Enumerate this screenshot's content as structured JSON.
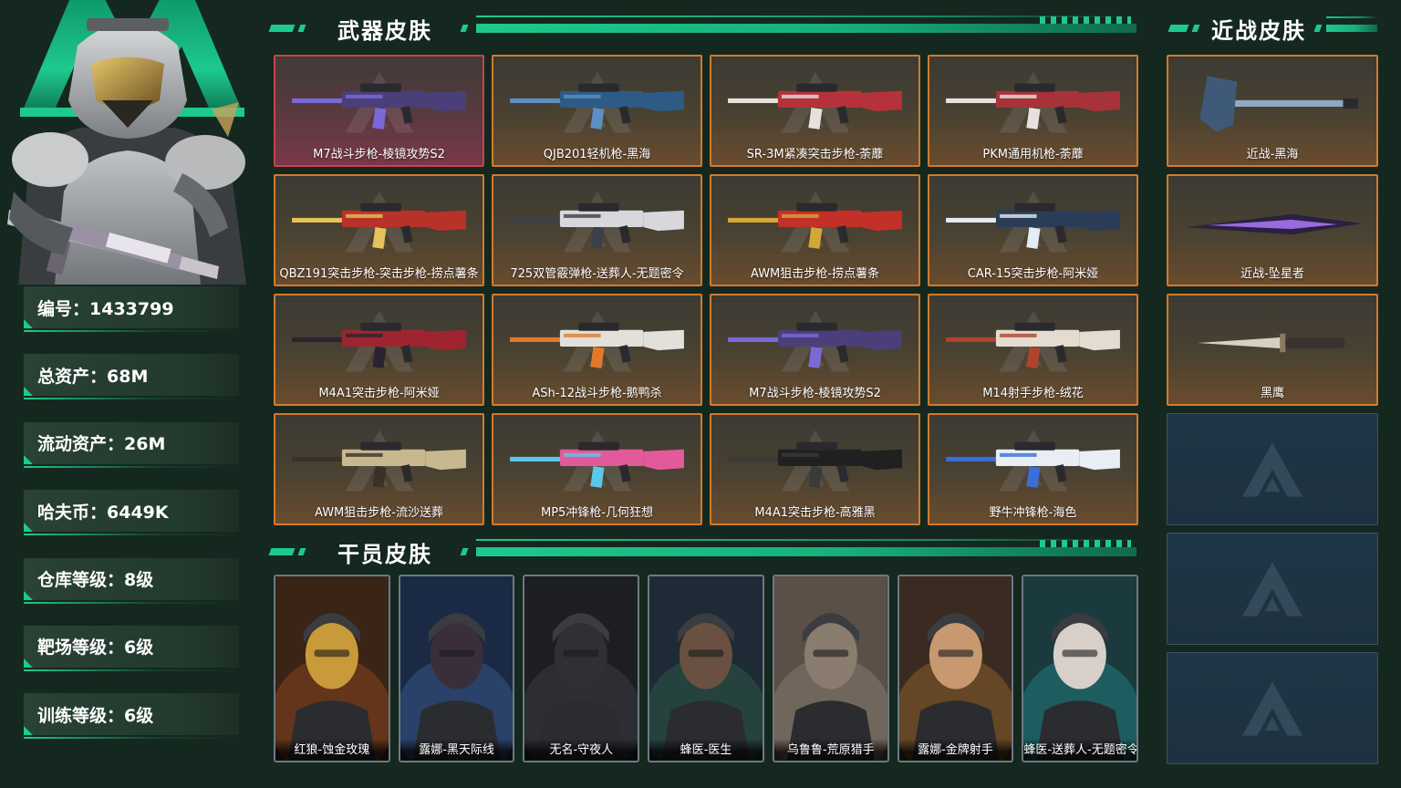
{
  "profile": {
    "stats": [
      {
        "label": "编号：1433799"
      },
      {
        "label": "总资产：68M"
      },
      {
        "label": "流动资产：26M"
      },
      {
        "label": "哈夫币：6449K"
      },
      {
        "label": "仓库等级：8级"
      },
      {
        "label": "靶场等级：6级"
      },
      {
        "label": "训练等级：6级"
      }
    ]
  },
  "sections": {
    "weapons_title": "武器皮肤",
    "melee_title": "近战皮肤",
    "operators_title": "干员皮肤"
  },
  "weapons": [
    {
      "name": "M7战斗步枪-棱镜攻势S2",
      "color": "#4b3f7a",
      "accent": "#7a6ad8",
      "rarity": "red"
    },
    {
      "name": "QJB201轻机枪-黑海",
      "color": "#2d5b86",
      "accent": "#5c8fc4",
      "rarity": "orange"
    },
    {
      "name": "SR-3M紧凑突击步枪-荼蘼",
      "color": "#b5323a",
      "accent": "#e8e0dc",
      "rarity": "orange"
    },
    {
      "name": "PKM通用机枪-荼蘼",
      "color": "#a8323a",
      "accent": "#e8e0dc",
      "rarity": "orange"
    },
    {
      "name": "QBZ191突击步枪-突击步枪-捞点薯条",
      "color": "#b8322a",
      "accent": "#e6c25a",
      "rarity": "orange"
    },
    {
      "name": "725双管霰弹枪-送葬人-无题密令",
      "color": "#d8d8dc",
      "accent": "#3a3f4a",
      "rarity": "orange"
    },
    {
      "name": "AWM狙击步枪-捞点薯条",
      "color": "#c23028",
      "accent": "#d4a838",
      "rarity": "orange"
    },
    {
      "name": "CAR-15突击步枪-阿米娅",
      "color": "#2a3c58",
      "accent": "#e4ecf4",
      "rarity": "orange"
    },
    {
      "name": "M4A1突击步枪-阿米娅",
      "color": "#9e2530",
      "accent": "#2a2430",
      "rarity": "orange"
    },
    {
      "name": "ASh-12战斗步枪-鹅鸭杀",
      "color": "#e2e0da",
      "accent": "#e07a2a",
      "rarity": "orange"
    },
    {
      "name": "M7战斗步枪-棱镜攻势S2",
      "color": "#4b3f7a",
      "accent": "#7a6ad8",
      "rarity": "orange"
    },
    {
      "name": "M14射手步枪-绒花",
      "color": "#e4dcd0",
      "accent": "#b0432e",
      "rarity": "orange"
    },
    {
      "name": "AWM狙击步枪-流沙送葬",
      "color": "#c8b890",
      "accent": "#3a3228",
      "rarity": "orange"
    },
    {
      "name": "MP5冲锋枪-几何狂想",
      "color": "#e35a9a",
      "accent": "#5ac8e8",
      "rarity": "orange"
    },
    {
      "name": "M4A1突击步枪-高雅黑",
      "color": "#202020",
      "accent": "#3a3a3a",
      "rarity": "orange"
    },
    {
      "name": "野牛冲锋枪-海色",
      "color": "#e8eef4",
      "accent": "#3a6ed8",
      "rarity": "orange"
    }
  ],
  "melee": [
    {
      "name": "近战-黑海",
      "color": "#3e5a78",
      "accent": "#8fa9c4"
    },
    {
      "name": "近战-坠星者",
      "color": "#2a2040",
      "accent": "#9a6ae0"
    },
    {
      "name": "黑鹰",
      "color": "#d8cfc4",
      "accent": "#3a3230"
    }
  ],
  "melee_empty_slots": 3,
  "operators": [
    {
      "name": "红狼-蚀金玫瑰",
      "bg": "#3a2416",
      "face": "#c89a3a",
      "glow": "#e0682a"
    },
    {
      "name": "露娜-黑天际线",
      "bg": "#1a2a44",
      "face": "#3a2e3a",
      "glow": "#5a88d8"
    },
    {
      "name": "无名-守夜人",
      "bg": "#1c1e22",
      "face": "#2e3034",
      "glow": "#5a5e66"
    },
    {
      "name": "蜂医-医生",
      "bg": "#1e2a36",
      "face": "#6a5040",
      "glow": "#3a8a5a"
    },
    {
      "name": "乌鲁鲁-荒原猎手",
      "bg": "#5a5048",
      "face": "#8a7c6e",
      "glow": "#b8a898"
    },
    {
      "name": "露娜-金牌射手",
      "bg": "#3a2a22",
      "face": "#c89870",
      "glow": "#e8a030"
    },
    {
      "name": "蜂医-送葬人-无题密令",
      "bg": "#1a3a3e",
      "face": "#d8d0c8",
      "glow": "#28c8c8"
    }
  ],
  "colors": {
    "accent": "#1ec98d",
    "background": "#15281f",
    "card_border": "#d27a2c",
    "card_border_red": "#c8424a"
  }
}
